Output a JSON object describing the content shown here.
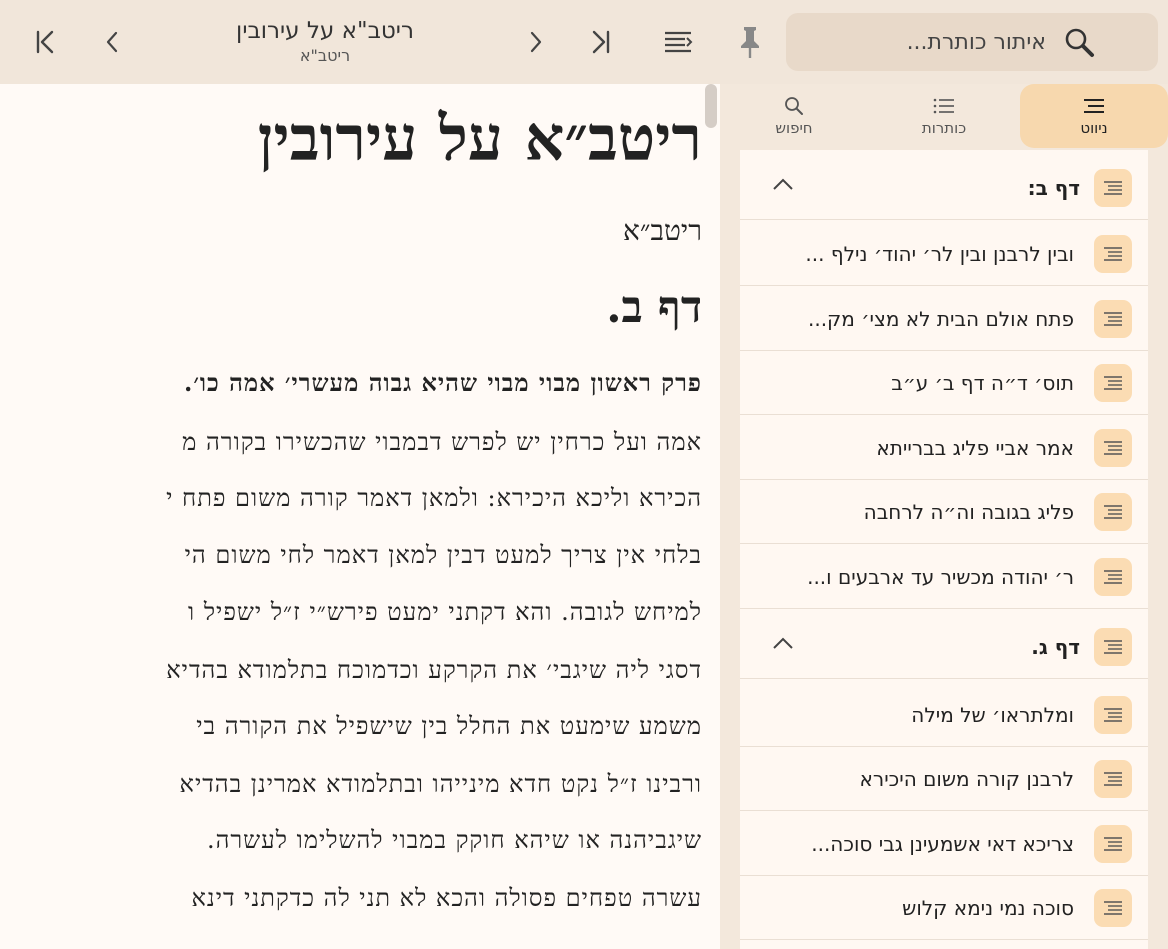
{
  "topbar": {
    "doc_title": "ריטב\"א על עירובין",
    "doc_subtitle": "ריטב\"א",
    "search_placeholder": "איתור כותרת..."
  },
  "reader": {
    "title": "ריטב״א על עירובין",
    "author": "ריטב״א",
    "daf": "דף ב.",
    "lines": [
      "פרק ראשון מבוי מבוי שהיא גבוה מעשרי׳ אמה כו׳.",
      "אמה ועל כרחין יש לפרש דבמבוי שהכשירו בקורה מ",
      "הכירא וליכא היכירא: ולמאן דאמר קורה משום פתח י",
      "בלחי אין צריך למעט דבין למאן דאמר לחי משום הי",
      "למיחש לגובה. והא דקתני ימעט פירש״י ז״ל ישפיל ו",
      "דסגי ליה שיגבי׳ את הקרקע וכדמוכח בתלמודא בהדיא",
      "משמע שימעט את החלל בין שישפיל את הקורה בי",
      "ורבינו ז״ל נקט חדא מינייהו ובתלמודא אמרינן בהדיא",
      "שיגביהנה או שיהא חוקק במבוי להשלימו לעשרה.",
      "עשרה טפחים פסולה והכא לא תני לה כדקתני דינא"
    ]
  },
  "side": {
    "tabs": [
      {
        "label": "ניווט",
        "icon": "menu-icon"
      },
      {
        "label": "כותרות",
        "icon": "list-icon"
      },
      {
        "label": "חיפוש",
        "icon": "search-icon"
      }
    ],
    "items": [
      {
        "label": "דף ב:",
        "type": "section"
      },
      {
        "label": "ובין לרבנן ובין לר׳ יהוד׳ נילף ...",
        "type": "item"
      },
      {
        "label": "פתח אולם הבית לא מצי׳ מק...",
        "type": "item"
      },
      {
        "label": "תוס׳ ד״ה דף ב׳ ע״ב",
        "type": "item"
      },
      {
        "label": "אמר אביי פליג בברייתא",
        "type": "item"
      },
      {
        "label": "פליג בגובה וה״ה לרחבה",
        "type": "item"
      },
      {
        "label": "ר׳ יהודה מכשיר עד ארבעים ו...",
        "type": "item"
      },
      {
        "label": "דף ג.",
        "type": "section"
      },
      {
        "label": "ומלתראו׳ של מילה",
        "type": "item"
      },
      {
        "label": "לרבנן קורה משום היכירא",
        "type": "item"
      },
      {
        "label": "צריכא דאי אשמעינן גבי סוכה...",
        "type": "item"
      },
      {
        "label": "סוכה נמי נימא קלוש",
        "type": "item"
      }
    ]
  }
}
